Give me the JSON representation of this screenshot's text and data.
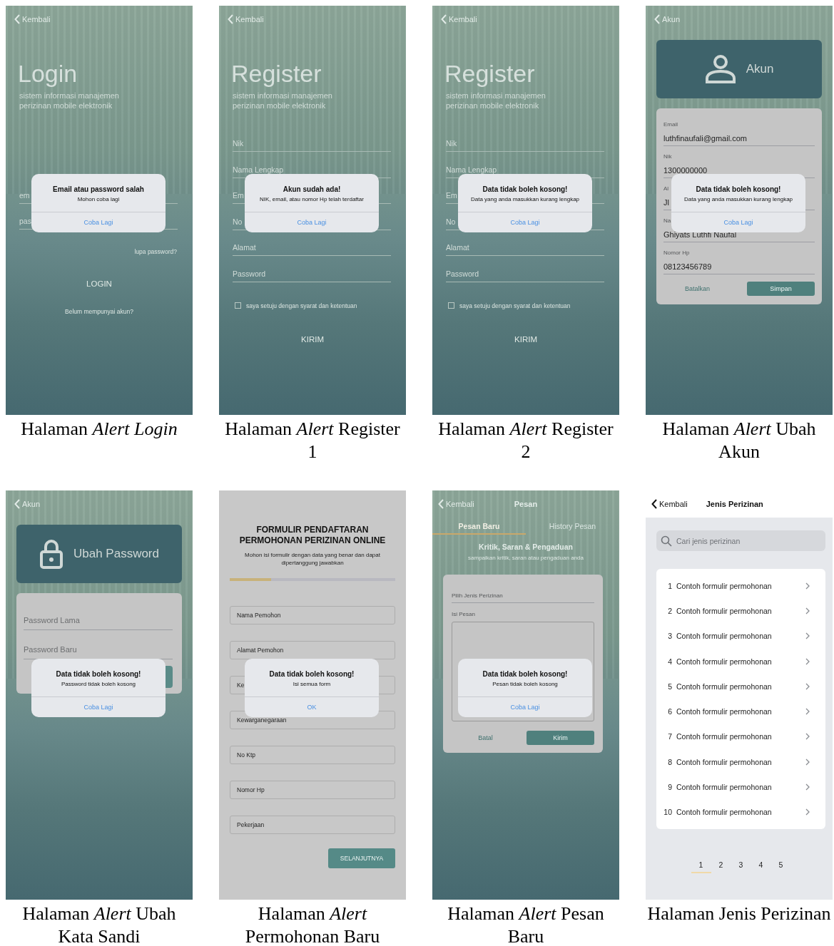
{
  "figures": [
    {
      "caption": "Halaman *Alert Login*",
      "screen": {
        "kind": "login",
        "back": "Kembali",
        "title": "Login",
        "subtitle": "sistem informasi manajemen perizinan mobile elektronik",
        "fields": [
          "em",
          "pas"
        ],
        "forgot": "lupa password?",
        "button": "LOGIN",
        "signup": "Belum mempunyai akun?",
        "alert": {
          "title": "Email atau password salah",
          "message": "Mohon coba lagi",
          "button": "Coba Lagi"
        }
      }
    },
    {
      "caption": "Halaman *Alert* Register 1",
      "screen": {
        "kind": "register",
        "back": "Kembali",
        "title": "Register",
        "subtitle": "sistem informasi manajemen perizinan mobile elektronik",
        "fields": [
          "Nik",
          "Nama Lengkap",
          "Em",
          "No",
          "Alamat",
          "Password"
        ],
        "agree": {
          "label": "saya setuju dengan syarat dan ketentuan",
          "checked": false
        },
        "button": "KIRIM",
        "alert": {
          "title": "Akun sudah ada!",
          "message": "NIK, email, atau nomor Hp telah terdaftar",
          "button": "Coba Lagi"
        }
      }
    },
    {
      "caption": "Halaman *Alert* Register 2",
      "screen": {
        "kind": "register",
        "back": "Kembali",
        "title": "Register",
        "subtitle": "sistem informasi manajemen perizinan mobile elektronik",
        "fields": [
          "Nik",
          "Nama Lengkap",
          "Em",
          "No",
          "Alamat",
          "Password"
        ],
        "agree": {
          "label": "saya setuju dengan syarat dan ketentuan",
          "checked": false
        },
        "button": "KIRIM",
        "alert": {
          "title": "Data tidak boleh kosong!",
          "message": "Data yang anda masukkan kurang lengkap",
          "button": "Coba Lagi"
        }
      }
    },
    {
      "caption": "Halaman *Alert* Ubah Akun",
      "screen": {
        "kind": "account",
        "back": "Akun",
        "header": "Akun",
        "fields": [
          {
            "label": "Email",
            "value": "luthfinaufali@gmail.com"
          },
          {
            "label": "Nik",
            "value": "1300000000"
          },
          {
            "label": "Al",
            "value": "Jl"
          },
          {
            "label": "Na",
            "value": "Ghiyats Luthfi Naufal"
          },
          {
            "label": "Nomor Hp",
            "value": "08123456789"
          }
        ],
        "cancel": "Batalkan",
        "save": "Simpan",
        "alert": {
          "title": "Data tidak boleh kosong!",
          "message": "Data yang anda masukkan kurang lengkap",
          "button": "Coba Lagi"
        }
      }
    },
    {
      "caption": "Halaman *Alert* Ubah Kata Sandi",
      "screen": {
        "kind": "password",
        "back": "Akun",
        "header": "Ubah Password",
        "fields": [
          "Password Lama",
          "Password Baru"
        ],
        "alert": {
          "title": "Data tidak boleh kosong!",
          "message": "Password tidak boleh kosong",
          "button": "Coba Lagi"
        }
      }
    },
    {
      "caption": "Halaman *Alert* Permohonan Baru",
      "screen": {
        "kind": "form",
        "title": "FORMULIR PENDAFTARAN PERMOHONAN PERIZINAN ONLINE",
        "subtitle": "Mohon isi formulir dengan data yang benar dan dapat dipertanggung jawabkan",
        "progress": {
          "level": 0.25
        },
        "fields": [
          "Nama Pemohon",
          "Alamat Pemohon",
          "Ke",
          "Kewarganegaraan",
          "No Ktp",
          "Nomor Hp",
          "Pekerjaan"
        ],
        "button": "SELANJUTNYA",
        "alert": {
          "title": "Data tidak boleh kosong!",
          "message": "Isi semua form",
          "button": "OK"
        }
      }
    },
    {
      "caption": "Halaman *Alert* Pesan Baru",
      "screen": {
        "kind": "message",
        "back": "Kembali",
        "title": "Pesan",
        "tabs": [
          {
            "label": "Pesan Baru",
            "selected": true
          },
          {
            "label": "History Pesan",
            "selected": false
          }
        ],
        "heading": "Kritik, Saran & Pengaduan",
        "subheading": "sampaikan kritik, saran atau pengaduan anda",
        "select_label": "Pilih Jenis Perizinan",
        "message_label": "Isi Pesan",
        "cancel": "Batal",
        "send": "Kirim",
        "alert": {
          "title": "Data tidak boleh kosong!",
          "message": "Pesan tidak boleh kosong",
          "button": "Coba Lagi"
        }
      }
    },
    {
      "caption": "Halaman Jenis Perizinan",
      "screen": {
        "kind": "list",
        "back": "Kembali",
        "title": "Jenis Perizinan",
        "search": {
          "placeholder": "Cari jenis perizinan"
        },
        "items": [
          {
            "number": "1",
            "label": "Contoh formulir permohonan"
          },
          {
            "number": "2",
            "label": "Contoh formulir permohonan"
          },
          {
            "number": "3",
            "label": "Contoh formulir permohonan"
          },
          {
            "number": "4",
            "label": "Contoh formulir permohonan"
          },
          {
            "number": "5",
            "label": "Contoh formulir permohonan"
          },
          {
            "number": "6",
            "label": "Contoh formulir permohonan"
          },
          {
            "number": "7",
            "label": "Contoh formulir permohonan"
          },
          {
            "number": "8",
            "label": "Contoh formulir permohonan"
          },
          {
            "number": "9",
            "label": "Contoh formulir permohonan"
          },
          {
            "number": "10",
            "label": "Contoh formulir permohonan"
          }
        ],
        "pages": [
          {
            "label": "1",
            "selected": true
          },
          {
            "label": "2",
            "selected": false
          },
          {
            "label": "3",
            "selected": false
          },
          {
            "label": "4",
            "selected": false
          },
          {
            "label": "5",
            "selected": false
          }
        ]
      }
    }
  ]
}
